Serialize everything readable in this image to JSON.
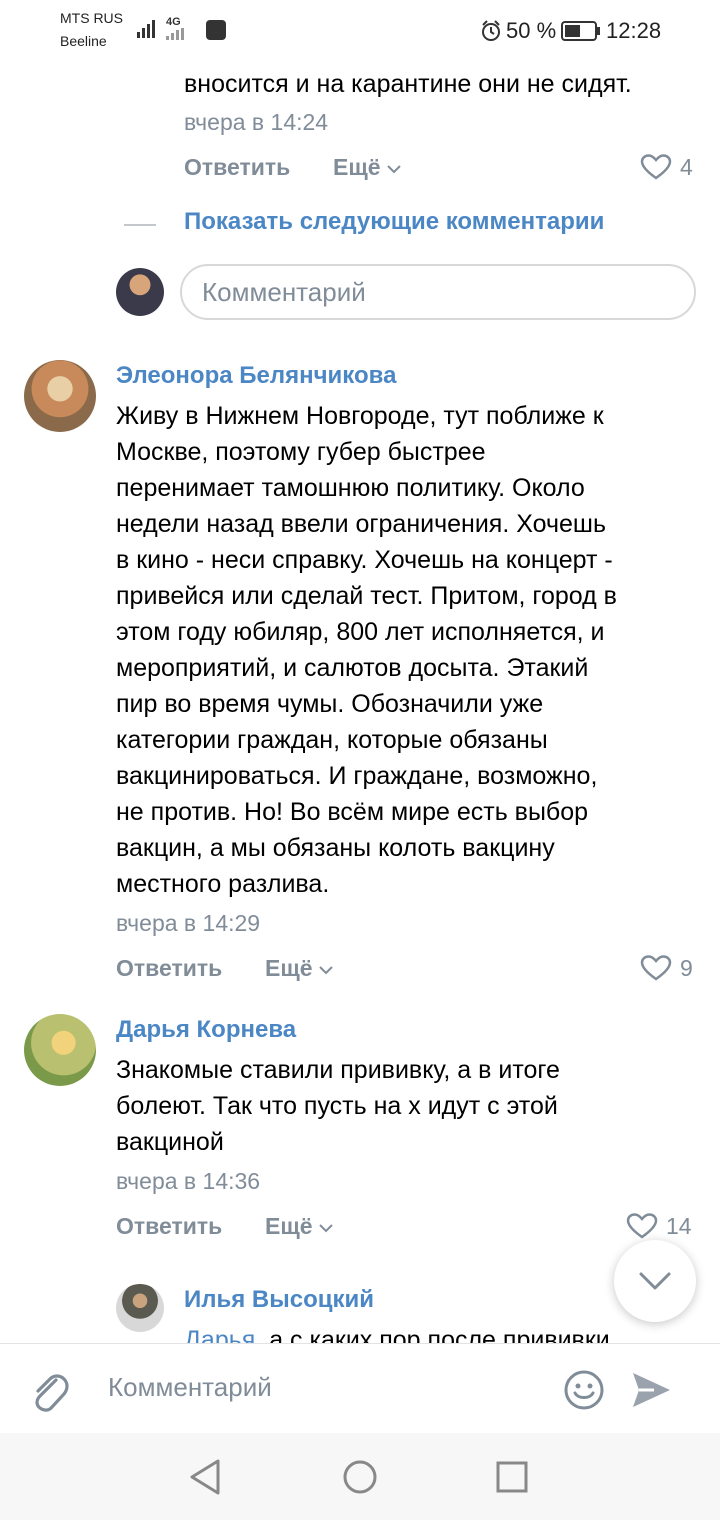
{
  "status_bar": {
    "carrier1": "MTS RUS",
    "carrier2": "Beeline",
    "network": "4G",
    "battery": "50 %",
    "time": "12:28"
  },
  "prev_comment": {
    "text_tail": "вносится и на карантине они не сидят.",
    "time": "вчера в 14:24",
    "reply_label": "Ответить",
    "more_label": "Ещё",
    "likes": "4"
  },
  "show_more": {
    "label": "Показать следующие комментарии"
  },
  "thread_input": {
    "placeholder": "Комментарий"
  },
  "comments": [
    {
      "author": "Элеонора Белянчикова",
      "lines": [
        "Живу в Нижнем Новгороде, тут поближе к",
        "Москве, поэтому губер быстрее",
        "перенимает тамошнюю политику. Около",
        "недели назад ввели ограничения. Хочешь",
        "в кино - неси справку. Хочешь на концерт -",
        "привейся или сделай тест. Притом, город в",
        "этом году юбиляр, 800 лет исполняется, и",
        "мероприятий, и салютов досыта. Этакий",
        "пир во время чумы. Обозначили уже",
        "категории граждан, которые обязаны",
        "вакцинироваться. И граждане, возможно,",
        "не против. Но! Во всём мире есть выбор",
        "вакцин, а мы обязаны колоть вакцину",
        "местного разлива."
      ],
      "time": "вчера в 14:29",
      "reply_label": "Ответить",
      "more_label": "Ещё",
      "likes": "9"
    },
    {
      "author": "Дарья Корнева",
      "lines": [
        "Знакомые ставили прививку, а в итоге",
        "болеют. Так что пусть на х идут с этой",
        "вакциной"
      ],
      "time": "вчера в 14:36",
      "reply_label": "Ответить",
      "more_label": "Ещё",
      "likes": "14"
    }
  ],
  "reply": {
    "author": "Илья Высоцкий",
    "mention": "Дарья",
    "text": ", а с каких пор после прививки"
  },
  "bottom_input": {
    "placeholder": "Комментарий"
  },
  "colors": {
    "link": "#4b86c5",
    "secondary": "#818c99",
    "divider": "#e1e3e6"
  },
  "icons": [
    "clip-icon",
    "emoji-icon",
    "send-icon",
    "heart-icon",
    "chevron-down-icon",
    "back-icon",
    "home-icon",
    "recents-icon",
    "alarm-icon",
    "battery-icon",
    "signal-icon"
  ]
}
